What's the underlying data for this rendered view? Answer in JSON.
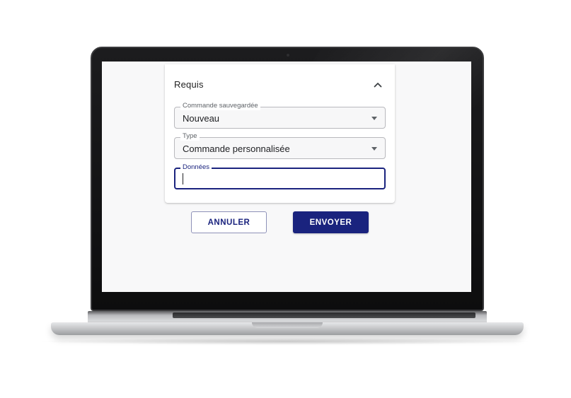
{
  "panel": {
    "title": "Requis",
    "toggle_icon": "chevron-up-icon"
  },
  "fields": {
    "saved_command": {
      "label": "Commande sauvegardée",
      "value": "Nouveau"
    },
    "type": {
      "label": "Type",
      "value": "Commande personnalisée"
    },
    "data": {
      "label": "Données",
      "value": ""
    }
  },
  "buttons": {
    "cancel": "ANNULER",
    "send": "ENVOYER"
  },
  "colors": {
    "accent": "#1a237e",
    "screen_bg": "#f8f8f9",
    "field_border": "#b9b9bd"
  }
}
